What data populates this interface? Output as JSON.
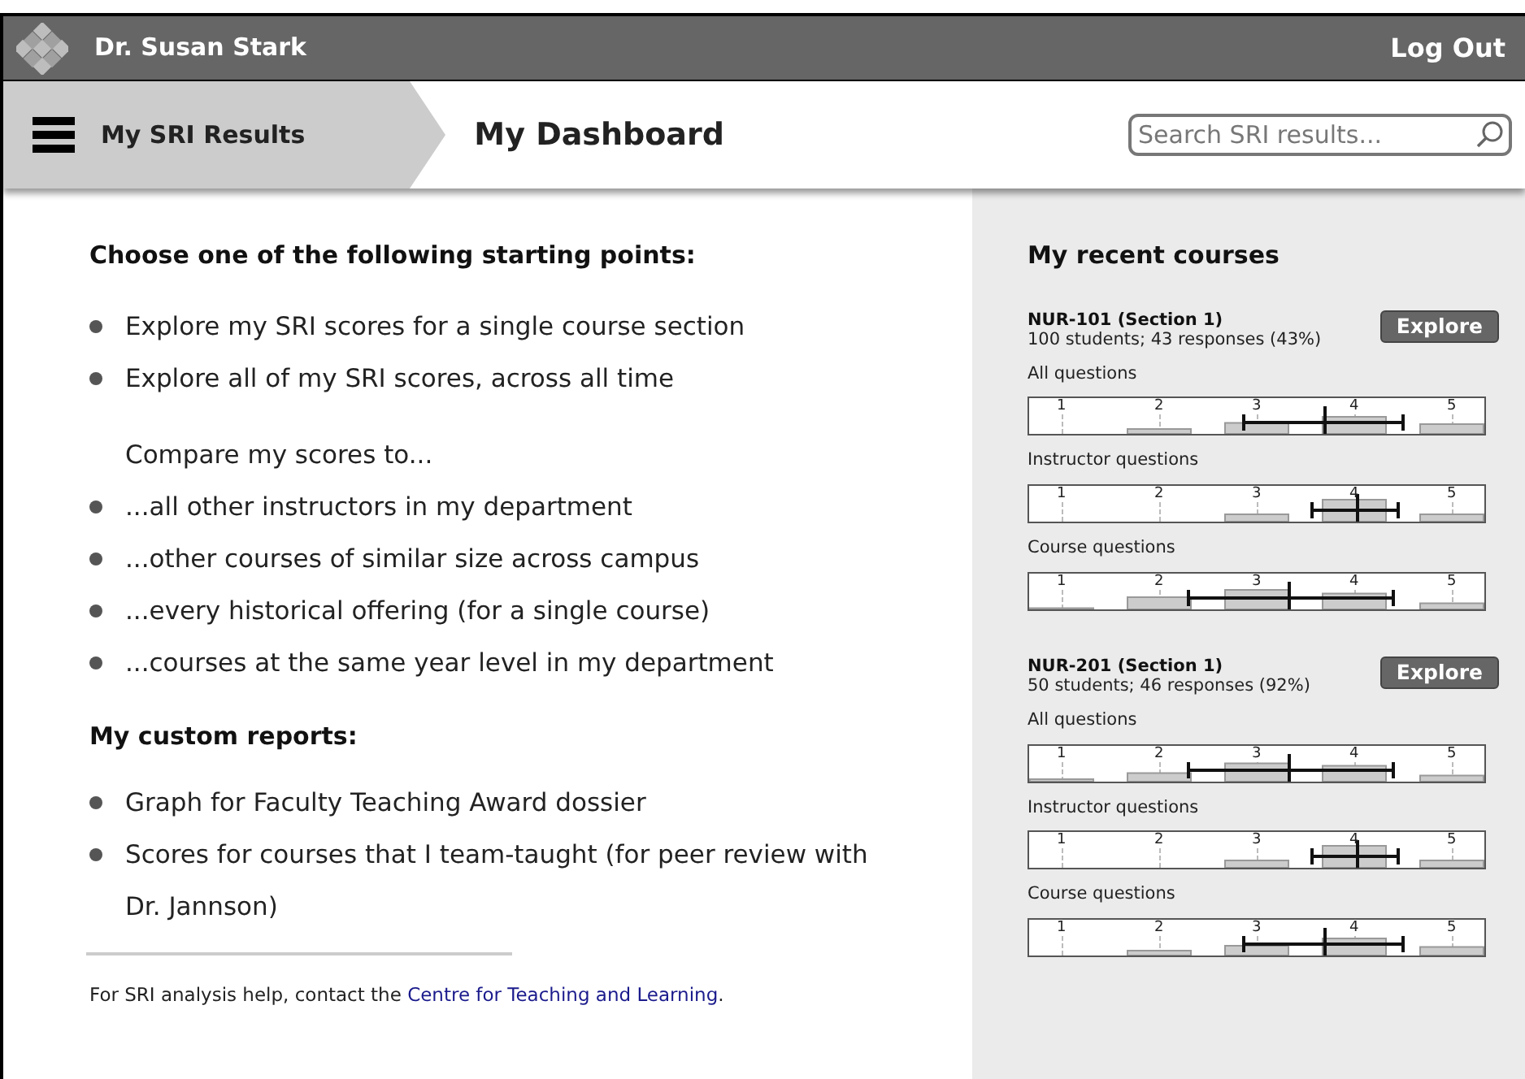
{
  "header": {
    "user_name": "Dr. Susan Stark",
    "logout": "Log Out"
  },
  "nav": {
    "breadcrumb": "My SRI Results",
    "page_title": "My Dashboard",
    "search": {
      "placeholder": "Search SRI results..."
    }
  },
  "main": {
    "heading": "Choose one of the following starting points:",
    "starting_points": [
      {
        "text": "Explore my SRI scores for a single course section"
      },
      {
        "text": "Explore all of my SRI scores, across all time"
      }
    ],
    "compare_heading": "Compare my scores to...",
    "compare_items": [
      {
        "text": "...all other instructors in my department"
      },
      {
        "text": "...other courses of similar size across campus"
      },
      {
        "text": "...every historical offering (for a single course)"
      },
      {
        "text": "...courses at the same year level in my department"
      }
    ],
    "custom_heading": "My custom reports:",
    "custom_reports": [
      {
        "text": "Graph for Faculty Teaching Award dossier"
      },
      {
        "text": "Scores for courses that I team-taught (for peer review with Dr. Jannson)"
      }
    ],
    "footer": {
      "text": "For SRI analysis help, contact the ",
      "link": "Centre for Teaching and Learning",
      "end": "."
    }
  },
  "recent": {
    "heading": "My recent courses",
    "courses": [
      {
        "title": "NUR-101 (Section 1)",
        "summary": "100 students; 43 responses (43%)",
        "button": "Explore",
        "charts": [
          {
            "label": "All questions",
            "scale_labels": [
              "1",
              "2",
              "3",
              "4",
              "5"
            ],
            "low": {
              "level": 0.47
            },
            "mean": {
              "level": 0.65
            },
            "high": {
              "level": 0.82
            }
          },
          {
            "label": "Instructor questions",
            "scale_labels": [
              "1",
              "2",
              "3",
              "4",
              "5"
            ],
            "low": {
              "level": 0.62
            },
            "mean": {
              "level": 0.72
            },
            "high": {
              "level": 0.81
            }
          },
          {
            "label": "Course questions",
            "scale_labels": [
              "1",
              "2",
              "3",
              "4",
              "5"
            ],
            "low": {
              "level": 0.35
            },
            "mean": {
              "level": 0.57
            },
            "high": {
              "level": 0.8
            }
          }
        ]
      },
      {
        "title": "NUR-201 (Section 1)",
        "summary": "50 students; 46 responses (92%)",
        "button": "Explore",
        "charts": [
          {
            "label": "All questions",
            "scale_labels": [
              "1",
              "2",
              "3",
              "4",
              "5"
            ],
            "low": {
              "level": 0.35
            },
            "mean": {
              "level": 0.57
            },
            "high": {
              "level": 0.8
            }
          },
          {
            "label": "Instructor questions",
            "scale_labels": [
              "1",
              "2",
              "3",
              "4",
              "5"
            ],
            "low": {
              "level": 0.62
            },
            "mean": {
              "level": 0.72
            },
            "high": {
              "level": 0.81
            }
          },
          {
            "label": "Course questions",
            "scale_labels": [
              "1",
              "2",
              "3",
              "4",
              "5"
            ],
            "low": {
              "level": 0.47
            },
            "mean": {
              "level": 0.65
            },
            "high": {
              "level": 0.82
            }
          }
        ]
      }
    ]
  }
}
